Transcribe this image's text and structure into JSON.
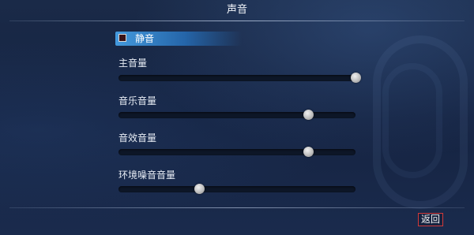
{
  "header": {
    "title": "声音"
  },
  "mute": {
    "label": "静音",
    "checked": false
  },
  "volumes": [
    {
      "label": "主音量",
      "level": 1.0
    },
    {
      "label": "音乐音量",
      "level": 0.8
    },
    {
      "label": "音效音量",
      "level": 0.8
    },
    {
      "label": "环境噪音音量",
      "level": 0.34
    }
  ],
  "footer": {
    "back_label": "返回"
  },
  "colors": {
    "accent": "#3c9be0",
    "back_border": "#d23a3a"
  }
}
